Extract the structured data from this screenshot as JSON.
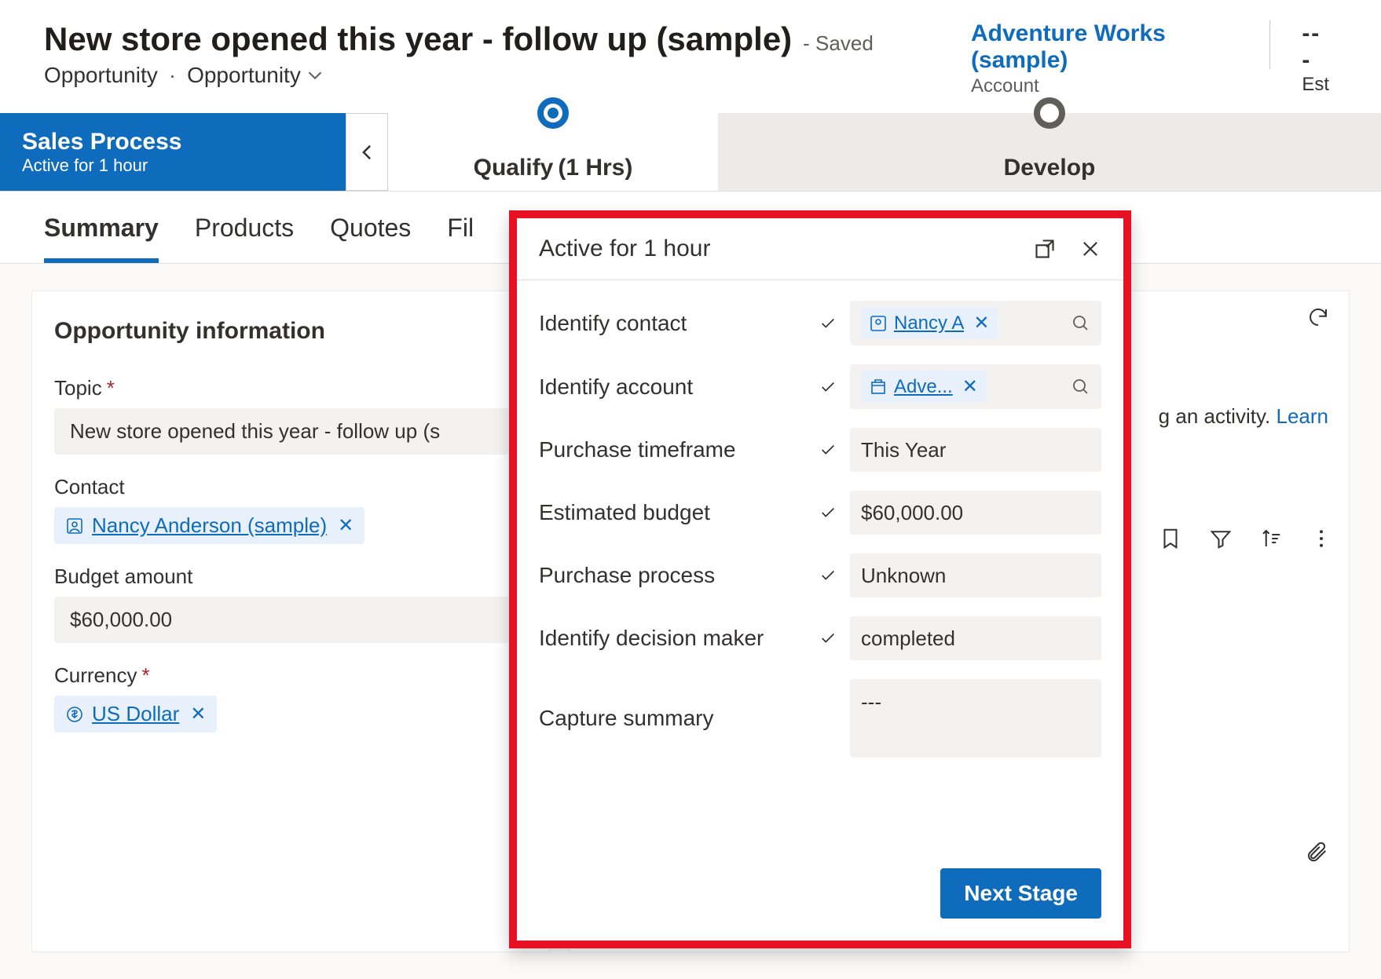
{
  "header": {
    "title": "New store opened this year - follow up (sample)",
    "saved_status": "- Saved",
    "breadcrumb_entity": "Opportunity",
    "breadcrumb_form": "Opportunity",
    "account": {
      "name": "Adventure Works (sample)",
      "label": "Account"
    },
    "est_label_truncated": "Est",
    "est_value": "---"
  },
  "bpf": {
    "name": "Sales Process",
    "duration": "Active for 1 hour",
    "stages": [
      {
        "label": "Qualify",
        "duration": "(1 Hrs)",
        "active": true
      },
      {
        "label": "Develop",
        "duration": "",
        "active": false
      }
    ]
  },
  "tabs": {
    "items": [
      "Summary",
      "Products",
      "Quotes",
      "Fil"
    ]
  },
  "opportunity_info": {
    "section_title": "Opportunity information",
    "topic": {
      "label": "Topic",
      "value": "New store opened this year - follow up (s"
    },
    "contact": {
      "label": "Contact",
      "value": "Nancy Anderson (sample)"
    },
    "budget": {
      "label": "Budget amount",
      "value": "$60,000.00"
    },
    "currency": {
      "label": "Currency",
      "value": "US Dollar"
    }
  },
  "timeline": {
    "hint_suffix": "an activity.",
    "learn_link": "Learn"
  },
  "flyout": {
    "title": "Active for 1 hour",
    "rows": {
      "identify_contact": {
        "label": "Identify contact",
        "value": "Nancy A",
        "is_lookup": true,
        "icon": "contact"
      },
      "identify_account": {
        "label": "Identify account",
        "value": "Adve...",
        "is_lookup": true,
        "icon": "account"
      },
      "purchase_timeframe": {
        "label": "Purchase timeframe",
        "value": "This Year"
      },
      "estimated_budget": {
        "label": "Estimated budget",
        "value": "$60,000.00"
      },
      "purchase_process": {
        "label": "Purchase process",
        "value": "Unknown"
      },
      "identify_decision_maker": {
        "label": "Identify decision maker",
        "value": "completed"
      },
      "capture_summary": {
        "label": "Capture summary",
        "value": "---"
      }
    },
    "next_stage_label": "Next Stage"
  }
}
